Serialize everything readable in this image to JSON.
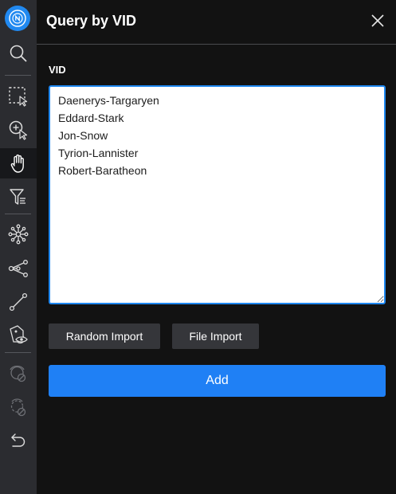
{
  "panel": {
    "title": "Query by VID",
    "close_icon": "close-icon"
  },
  "vid_field": {
    "label": "VID",
    "value": "Daenerys-Targaryen\nEddard-Stark\nJon-Snow\nTyrion-Lannister\nRobert-Baratheon"
  },
  "buttons": {
    "random_import": "Random Import",
    "file_import": "File Import",
    "add": "Add"
  },
  "sidebar": {
    "logo_icon": "nebula-logo-icon",
    "tools": [
      {
        "icon": "search-icon",
        "state": "normal"
      },
      {
        "icon": "box-select-icon",
        "state": "normal"
      },
      {
        "icon": "zoom-select-icon",
        "state": "normal"
      },
      {
        "icon": "hand-icon",
        "state": "active"
      },
      {
        "icon": "filter-icon",
        "state": "normal"
      },
      {
        "icon": "expand-icon",
        "state": "normal"
      },
      {
        "icon": "common-neighbor-icon",
        "state": "normal"
      },
      {
        "icon": "find-path-icon",
        "state": "normal"
      },
      {
        "icon": "show-properties-icon",
        "state": "normal"
      },
      {
        "icon": "hide-icon",
        "state": "disabled"
      },
      {
        "icon": "hide-others-icon",
        "state": "disabled"
      },
      {
        "icon": "undo-icon",
        "state": "normal"
      }
    ]
  },
  "colors": {
    "accent": "#1f80f5",
    "sidebar_bg": "#2b2c30",
    "panel_bg": "#121212",
    "secondary_button": "#35363a",
    "active_tool_bg": "#17181b"
  }
}
